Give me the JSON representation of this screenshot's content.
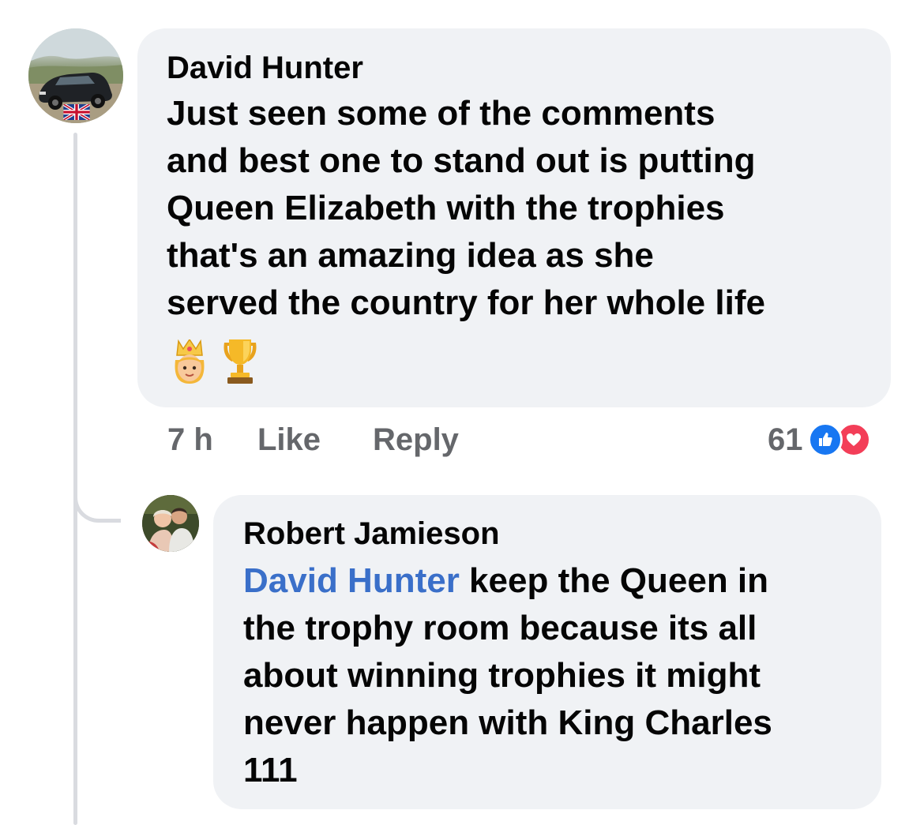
{
  "comment": {
    "author": "David Hunter",
    "lines": [
      "Just seen some of the comments",
      "and best one to stand out is putting",
      "Queen Elizabeth with the trophies",
      "that's an amazing idea as she",
      "served the country for her whole life"
    ],
    "emojis": [
      "princess-emoji",
      "trophy-emoji"
    ],
    "timestamp": "7 h",
    "like_label": "Like",
    "reply_label": "Reply",
    "reaction_count": "61",
    "reaction_icons": [
      "like-icon",
      "love-icon"
    ],
    "colors": {
      "like": "#1877f2",
      "love": "#f33e58"
    }
  },
  "reply": {
    "author": "Robert Jamieson",
    "mention": "David Hunter",
    "first_line_rest": " keep the Queen in",
    "lines": [
      "the trophy room because its all",
      "about winning trophies it might",
      "never happen with King Charles",
      "111"
    ],
    "colors": {
      "mention": "#3a6fc9"
    }
  }
}
